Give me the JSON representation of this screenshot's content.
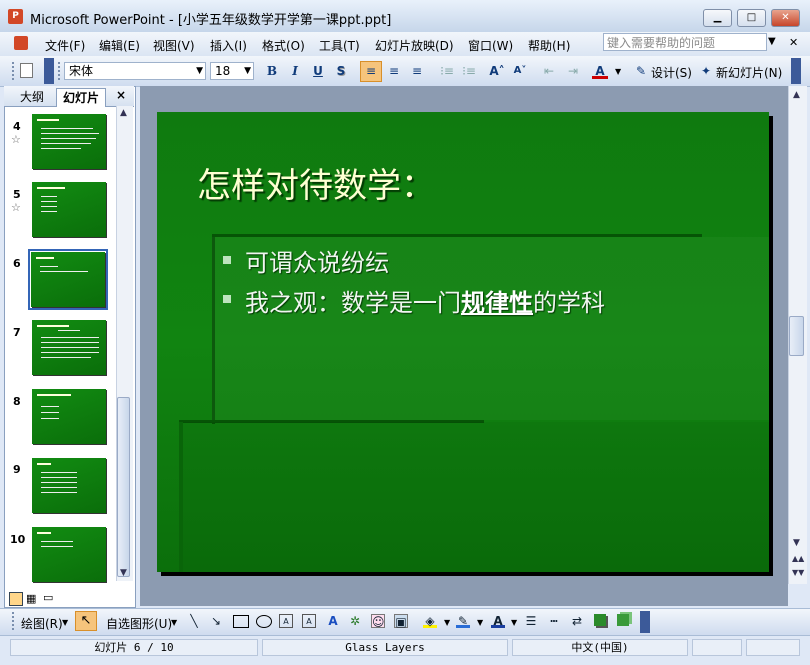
{
  "window": {
    "app_icon_letter": "P",
    "title": "Microsoft PowerPoint - [小学五年级数学开学第一课ppt.ppt]",
    "buttons": {
      "minimize": "▁",
      "maximize": "□",
      "close": "✕"
    }
  },
  "menu": {
    "items": [
      {
        "label": "文件(F)"
      },
      {
        "label": "编辑(E)"
      },
      {
        "label": "视图(V)"
      },
      {
        "label": "插入(I)"
      },
      {
        "label": "格式(O)"
      },
      {
        "label": "工具(T)"
      },
      {
        "label": "幻灯片放映(D)"
      },
      {
        "label": "窗口(W)"
      },
      {
        "label": "帮助(H)"
      }
    ],
    "help_placeholder": "键入需要帮助的问题"
  },
  "toolbar": {
    "font_name": "宋体",
    "font_size": "18",
    "bold": "B",
    "italic": "I",
    "underline": "U",
    "shadow": "S",
    "font_color_letter": "A",
    "design_label": "设计(S)",
    "new_slide_label": "新幻灯片(N)"
  },
  "left_pane": {
    "tabs": [
      {
        "label": "大纲"
      },
      {
        "label": "幻灯片"
      }
    ],
    "close": "×",
    "thumbnails": [
      {
        "number": "4",
        "has_animation": true
      },
      {
        "number": "5",
        "has_animation": true
      },
      {
        "number": "6",
        "has_animation": false,
        "selected": true
      },
      {
        "number": "7",
        "has_animation": false
      },
      {
        "number": "8",
        "has_animation": false
      },
      {
        "number": "9",
        "has_animation": false
      },
      {
        "number": "10",
        "has_animation": false
      }
    ],
    "animation_icon": "☆"
  },
  "slide": {
    "title": "怎样对待数学：",
    "bullets": [
      {
        "text": "可谓众说纷纭"
      },
      {
        "prefix": "我之观：数学是一门",
        "emphasis": "规律性",
        "suffix": "的学科"
      }
    ]
  },
  "drawing_toolbar": {
    "draw_label": "绘图(R)",
    "autoshapes_label": "自选图形(U)"
  },
  "status": {
    "slide_position": "幻灯片 6 / 10",
    "design_template": "Glass Layers",
    "language": "中文(中国)"
  },
  "colors": {
    "slide_background": "#118411",
    "title_text": "#ffffd2",
    "selection_border": "#3465b7"
  }
}
